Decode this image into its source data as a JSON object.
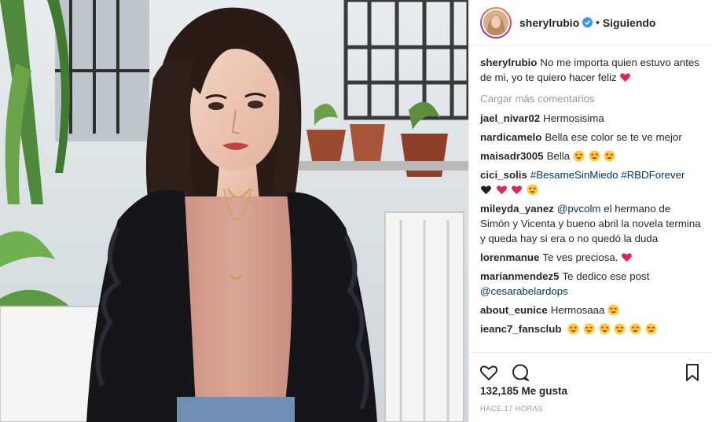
{
  "header": {
    "username": "sherylrubio",
    "separator": "•",
    "follow_status": "Siguiendo"
  },
  "caption": {
    "username": "sherylrubio",
    "text": "No me importa quien estuvo antes de mi, yo te quiero hacer feliz",
    "emoji": [
      "heart-emoji"
    ]
  },
  "load_more": "Cargar más comentarios",
  "comments": [
    {
      "user": "jael_nivar02",
      "text": "Hermosisima"
    },
    {
      "user": "nardicamelo",
      "text": "Bella ese color se te ve mejor"
    },
    {
      "user": "maisadr3005",
      "text": "Bella",
      "emoji": [
        "heart-eyes-emoji",
        "heart-eyes-emoji",
        "heart-eyes-emoji"
      ]
    },
    {
      "user": "cici_solis",
      "tags": [
        "#BesameSinMiedo",
        "#RBDForever"
      ],
      "emoji": [
        "black-heart-emoji",
        "heart-emoji",
        "heart-emoji",
        "heart-eyes-emoji"
      ]
    },
    {
      "user": "mileyda_yanez",
      "mention": "@pvcolm",
      "text": "el hermano de Simón y Vicenta y bueno abril la novela termina y queda hay si era o no quedó la duda"
    },
    {
      "user": "lorenmanue",
      "text": "Te ves preciosa.",
      "emoji": [
        "heart-emoji"
      ]
    },
    {
      "user": "marianmendez5",
      "text": "Te dedico ese post",
      "mention": "@cesarabelardops"
    },
    {
      "user": "about_eunice",
      "text": "Hermosaaa",
      "emoji": [
        "heart-eyes-emoji"
      ]
    },
    {
      "user": "ieanc7_fansclub",
      "text": "",
      "emoji": [
        "heart-eyes-emoji",
        "heart-eyes-emoji",
        "heart-eyes-emoji",
        "heart-eyes-emoji",
        "heart-eyes-emoji",
        "heart-eyes-emoji"
      ]
    }
  ],
  "likes": "132,185 Me gusta",
  "timestamp": "HACE 17 HORAS",
  "icons": {
    "like": "heart-outline-icon",
    "comment": "speech-bubble-icon",
    "save": "bookmark-icon",
    "verified": "verified-badge-icon"
  },
  "colors": {
    "link": "#003569",
    "muted": "#999999",
    "verified": "#3897f0",
    "heart": "#e0245e"
  }
}
